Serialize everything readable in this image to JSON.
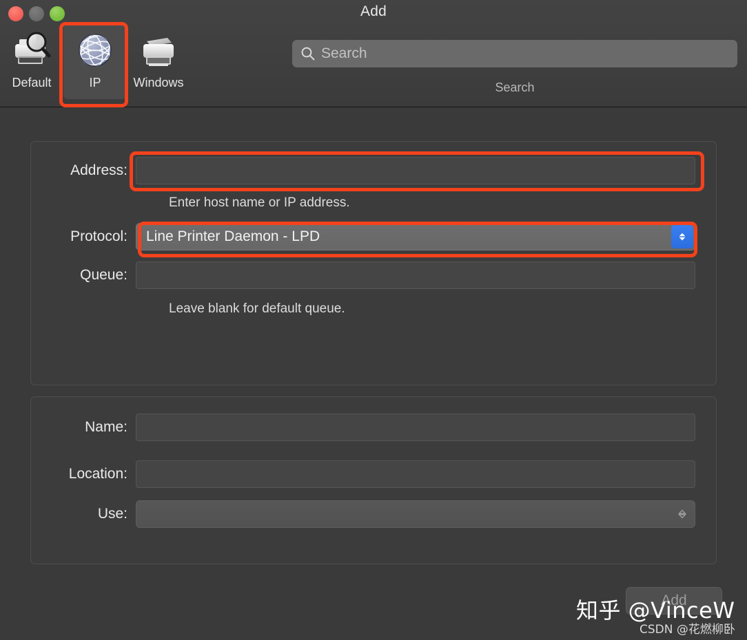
{
  "window": {
    "title": "Add",
    "controls": [
      {
        "name": "close",
        "icon": "close-traffic-light"
      },
      {
        "name": "minimize",
        "icon": "minimize-traffic-light"
      },
      {
        "name": "zoom",
        "icon": "zoom-traffic-light"
      }
    ]
  },
  "toolbar": {
    "tabs": [
      {
        "id": "default",
        "label": "Default",
        "icon": "printer-magnifier-icon",
        "selected": false
      },
      {
        "id": "ip",
        "label": "IP",
        "icon": "globe-network-icon",
        "selected": true
      },
      {
        "id": "windows",
        "label": "Windows",
        "icon": "printer-allinone-icon",
        "selected": false
      }
    ],
    "search": {
      "icon": "search-icon",
      "value": "",
      "placeholder": "Search",
      "caption": "Search"
    }
  },
  "form": {
    "connection": {
      "address": {
        "label": "Address:",
        "value": "",
        "placeholder": "",
        "hint": "Enter host name or IP address."
      },
      "protocol": {
        "label": "Protocol:",
        "value": "Line Printer Daemon - LPD",
        "stepper_icon": "chevron-up-down-icon"
      },
      "queue": {
        "label": "Queue:",
        "value": "",
        "placeholder": "",
        "hint": "Leave blank for default queue."
      }
    },
    "identity": {
      "name": {
        "label": "Name:",
        "value": "",
        "placeholder": ""
      },
      "location": {
        "label": "Location:",
        "value": "",
        "placeholder": ""
      },
      "use": {
        "label": "Use:",
        "value": "",
        "stepper_icon": "chevron-up-down-icon"
      }
    }
  },
  "footer": {
    "add_label": "Add"
  },
  "annotations": {
    "color": "#f4421c",
    "targets": [
      "ip-tab",
      "address-field",
      "protocol-popup"
    ]
  },
  "watermarks": {
    "zhihu": "知乎 @VinceW",
    "csdn": "CSDN @花燃柳卧"
  }
}
